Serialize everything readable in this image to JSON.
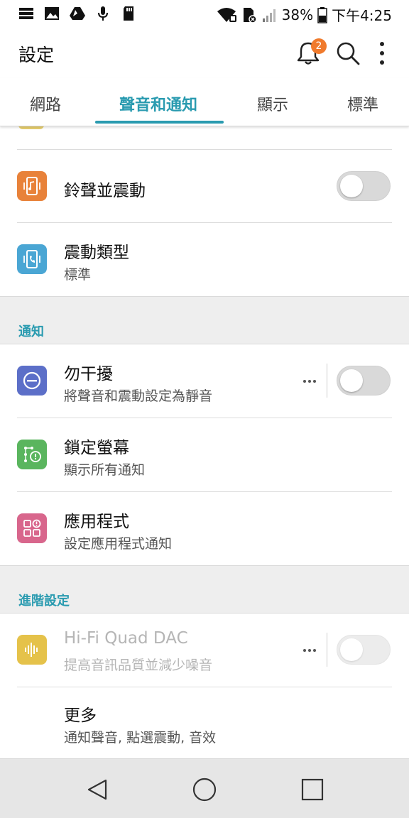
{
  "status_bar": {
    "battery_percent": "38%",
    "time": "下午4:25",
    "icons": [
      "storage-icon",
      "image-icon",
      "drive-icon",
      "mic-icon",
      "sdcard-icon",
      "wifi-icon",
      "sim-icon",
      "signal-icon",
      "battery-icon"
    ]
  },
  "app_bar": {
    "title": "設定",
    "notification_count": "2"
  },
  "tabs": [
    {
      "label": "網路"
    },
    {
      "label": "聲音和通知",
      "active": true
    },
    {
      "label": "顯示"
    },
    {
      "label": "標準"
    }
  ],
  "rows": {
    "ring_vibrate": {
      "title": "鈴聲並震動",
      "toggle": false,
      "icon": "ring-vibrate-icon",
      "color": "#e8823a"
    },
    "vibration_type": {
      "title": "震動類型",
      "subtitle": "標準",
      "icon": "vibration-phone-icon",
      "color": "#4aa6d4"
    }
  },
  "section_notifications": {
    "label": "通知",
    "rows": {
      "dnd": {
        "title": "勿干擾",
        "subtitle": "將聲音和震動設定為靜音",
        "toggle": false,
        "icon": "do-not-disturb-icon",
        "color": "#5c6fc8"
      },
      "lock_screen": {
        "title": "鎖定螢幕",
        "subtitle": "顯示所有通知",
        "icon": "lock-screen-icon",
        "color": "#5ab55e"
      },
      "apps": {
        "title": "應用程式",
        "subtitle": "設定應用程式通知",
        "icon": "apps-icon",
        "color": "#d8668c"
      }
    }
  },
  "section_advanced": {
    "label": "進階設定",
    "rows": {
      "hifi": {
        "title": "Hi-Fi Quad DAC",
        "subtitle": "提高音訊品質並減少噪音",
        "toggle": false,
        "disabled": true,
        "icon": "audio-wave-icon",
        "color": "#e5c24a"
      },
      "more": {
        "title": "更多",
        "subtitle": "通知聲音, 點選震動, 音效"
      }
    }
  },
  "nav": {
    "buttons": [
      "back-icon",
      "home-icon",
      "recents-icon"
    ]
  },
  "colors": {
    "accent": "#2a9bb0",
    "badge": "#f07a2c"
  }
}
